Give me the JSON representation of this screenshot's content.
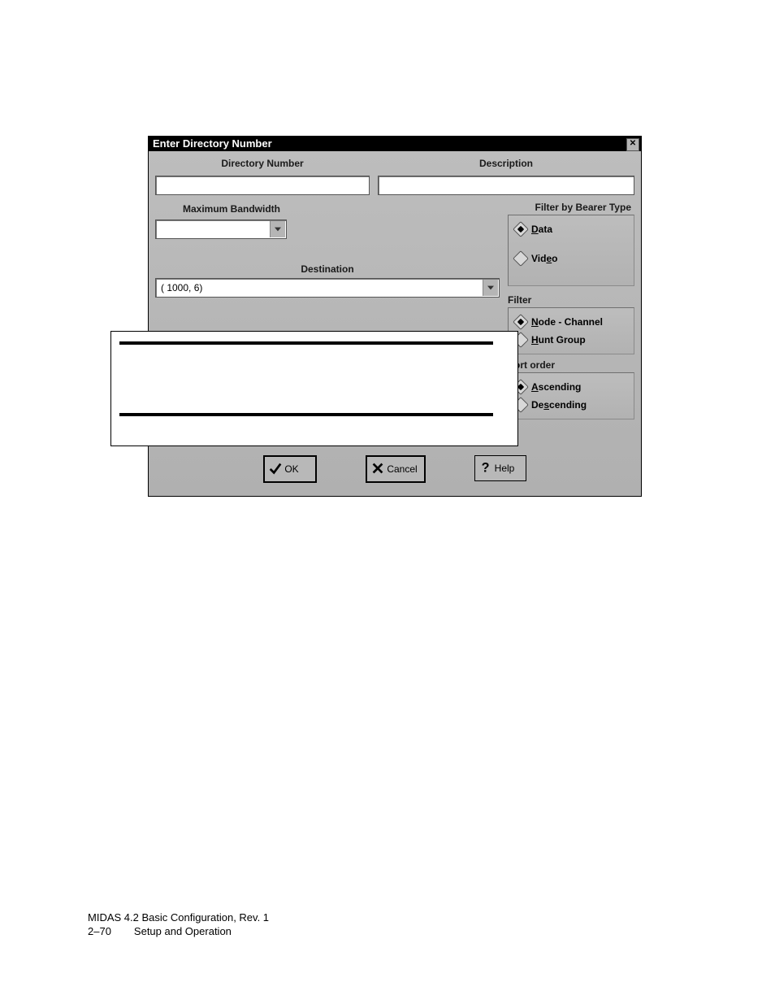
{
  "dialog": {
    "title": "Enter Directory Number",
    "labels": {
      "directory_number": "Directory Number",
      "description": "Description",
      "max_bandwidth": "Maximum Bandwidth",
      "destination": "Destination"
    },
    "destination_value": "( 1000, 6)",
    "bearer_group": {
      "title": "Filter by Bearer Type",
      "options": {
        "data": "Data",
        "video": "Video"
      },
      "selected": "data"
    },
    "filter_group": {
      "title": "Filter",
      "options": {
        "node_channel": "Node - Channel",
        "hunt_group": "Hunt Group"
      },
      "selected": "node_channel"
    },
    "sort_group": {
      "title": "Sort order",
      "options": {
        "ascending": "Ascending",
        "descending": "Descending"
      },
      "selected": "ascending"
    },
    "buttons": {
      "ok": "OK",
      "cancel": "Cancel",
      "help": "Help"
    }
  },
  "footer": {
    "line1": "MIDAS 4.2 Basic Configuration,  Rev. 1",
    "page_num": "2–70",
    "section": "Setup and Operation"
  }
}
